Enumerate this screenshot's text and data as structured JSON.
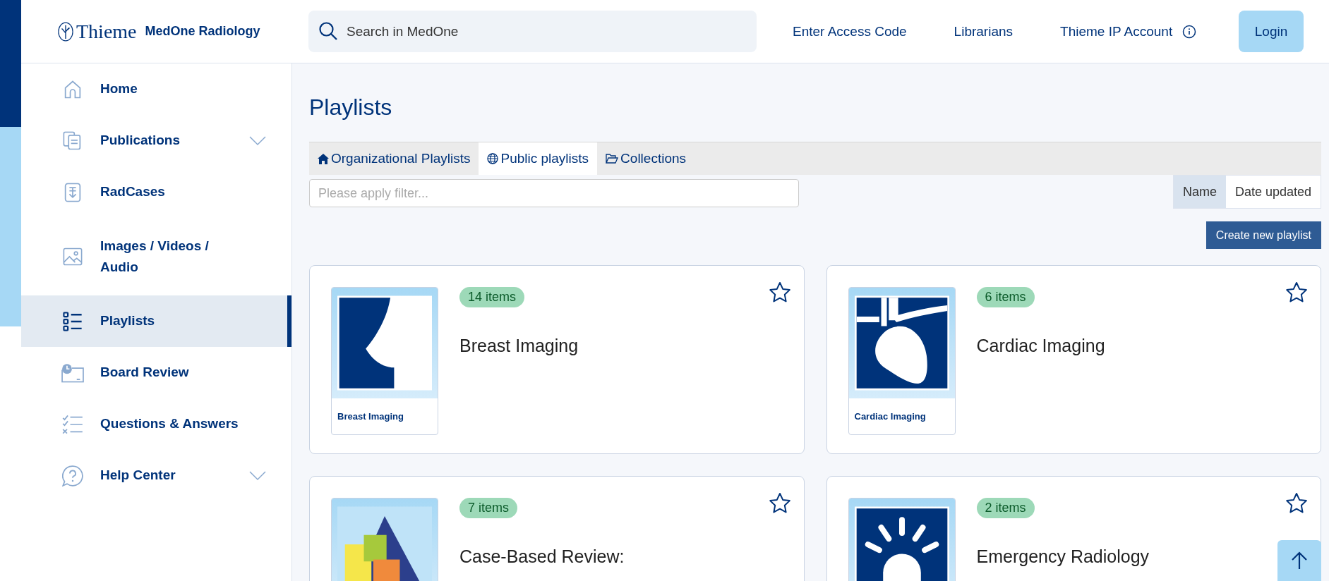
{
  "header": {
    "logo": {
      "brand": "Thieme",
      "product": "MedOne Radiology"
    },
    "search": {
      "placeholder": "Search in MedOne"
    },
    "links": [
      "Enter Access Code",
      "Librarians",
      "Thieme IP Account"
    ],
    "login": "Login"
  },
  "sidebar": {
    "items": [
      {
        "label": "Home",
        "kind": "link",
        "selected": false
      },
      {
        "label": "Publications",
        "kind": "menu",
        "expanded": false,
        "selected": false
      },
      {
        "label": "RadCases",
        "kind": "link",
        "selected": false
      },
      {
        "label": "Images / Videos / Audio",
        "kind": "link",
        "selected": false
      },
      {
        "label": "Playlists",
        "kind": "link",
        "selected": true
      },
      {
        "label": "Board Review",
        "kind": "link",
        "selected": false
      },
      {
        "label": "Questions & Answers",
        "kind": "link",
        "selected": false
      },
      {
        "label": "Help Center",
        "kind": "menu",
        "expanded": false,
        "selected": false
      }
    ]
  },
  "page": {
    "title": "Playlists",
    "tabs": [
      {
        "label": "Organizational Playlists",
        "selected": false
      },
      {
        "label": "Public playlists",
        "selected": true
      },
      {
        "label": "Collections",
        "selected": false
      }
    ],
    "filter": {
      "placeholder": "Please apply filter..."
    },
    "sort": [
      {
        "label": "Name",
        "selected": true
      },
      {
        "label": "Date updated",
        "selected": false
      }
    ],
    "create_button": "Create new playlist",
    "cards": [
      {
        "count": "14 items",
        "title": "Breast Imaging",
        "caption": "Breast Imaging",
        "starred": false
      },
      {
        "count": "6 items",
        "title": "Cardiac Imaging",
        "caption": "Cardiac Imaging",
        "starred": false
      },
      {
        "count": "7 items",
        "title": "Case-Based Review:",
        "starred": false
      },
      {
        "count": "2 items",
        "title": "Emergency Radiology",
        "starred": false
      }
    ]
  }
}
